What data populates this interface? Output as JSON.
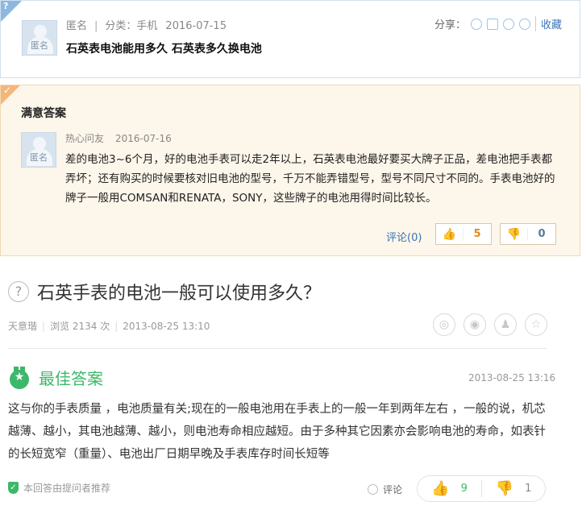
{
  "question_card": {
    "corner_icon": "question-mark-icon",
    "avatar_label": "匿名",
    "author": "匿名",
    "category": "分类：手机",
    "date": "2016-07-15",
    "title": "石英表电池能用多久 石英表多久换电池",
    "share_label": "分享：",
    "share_icons": [
      "search-share-icon",
      "star-share-icon",
      "qq-share-icon",
      "weibo-share-icon"
    ],
    "collect_label": "收藏"
  },
  "satisfied_answer": {
    "corner_icon": "checkmark-icon",
    "heading": "满意答案",
    "avatar_label": "匿名",
    "author": "热心问友",
    "date": "2016-07-16",
    "text": "差的电池3~6个月，好的电池手表可以走2年以上，石英表电池最好要买大牌子正品，差电池把手表都弄坏；还有购买的时候要核对旧电池的型号，千万不能弄错型号，型号不同尺寸不同的。手表电池好的牌子一般用COMSAN和RENATA，SONY，这些牌子的电池用得时间比较长。",
    "comment_label": "评论(0)",
    "upvotes": "5",
    "downvotes": "0"
  },
  "lower_question": {
    "title": "石英手表的电池一般可以使用多久？",
    "author": "天意瑎",
    "views": "浏览 2134 次",
    "date": "2013-08-25 13:10",
    "share_icons": [
      "wechat-icon",
      "weibo-icon",
      "qq-icon",
      "star-icon"
    ]
  },
  "best_answer": {
    "heading": "最佳答案",
    "date": "2013-08-25 13:16",
    "text": "这与你的手表质量 ，电池质量有关;现在的一般电池用在手表上的一般一年到两年左右 ，一般的说，机芯越薄、越小，其电池越薄、越小，则电池寿命相应越短。由于多种其它因素亦会影响电池的寿命，如表针的长短宽窄（重量）、电池出厂日期早晚及手表库存时间长短等",
    "recommend_label": "本回答由提问者推荐",
    "comment_label": "评论",
    "upvotes": "9",
    "downvotes": "1"
  },
  "colors": {
    "link_blue": "#3a74b5",
    "best_green": "#3db86a",
    "vote_orange": "#e08b1c"
  }
}
